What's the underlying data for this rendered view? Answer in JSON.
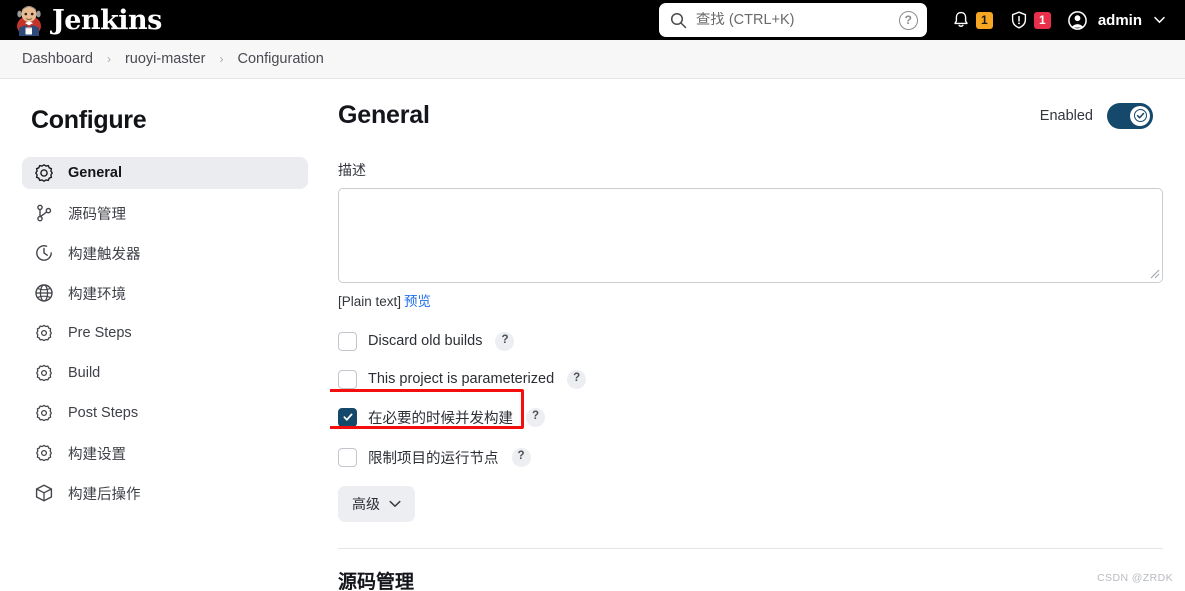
{
  "topbar": {
    "brand": "Jenkins",
    "logo_icon": "jenkins-butler-logo",
    "search": {
      "icon": "search-icon",
      "placeholder": "查找 (CTRL+K)",
      "value": "",
      "help_icon": "question-mark-icon",
      "help_label": "?"
    },
    "notifications": {
      "icon": "bell-icon",
      "count": "1",
      "color": "#f5a623"
    },
    "security": {
      "icon": "shield-warning-icon",
      "count": "1",
      "color": "#e8304a"
    },
    "user": {
      "icon": "user-avatar-icon",
      "name": "admin",
      "caret_icon": "chevron-down-icon"
    }
  },
  "breadcrumb": {
    "separator": "›",
    "items": [
      {
        "label": "Dashboard"
      },
      {
        "label": "ruoyi-master"
      },
      {
        "label": "Configuration"
      }
    ]
  },
  "sidebar": {
    "title": "Configure",
    "items": [
      {
        "label": "General",
        "icon": "gear-icon",
        "active": true
      },
      {
        "label": "源码管理",
        "icon": "git-branch-icon",
        "active": false
      },
      {
        "label": "构建触发器",
        "icon": "clock-icon",
        "active": false
      },
      {
        "label": "构建环境",
        "icon": "globe-icon",
        "active": false
      },
      {
        "label": "Pre Steps",
        "icon": "gear-icon",
        "active": false
      },
      {
        "label": "Build",
        "icon": "gear-icon",
        "active": false
      },
      {
        "label": "Post Steps",
        "icon": "gear-icon",
        "active": false
      },
      {
        "label": "构建设置",
        "icon": "gear-icon",
        "active": false
      },
      {
        "label": "构建后操作",
        "icon": "package-box-icon",
        "active": false
      }
    ]
  },
  "main": {
    "title": "General",
    "enabled": {
      "label": "Enabled",
      "state": "on",
      "toggle_color": "#14496b",
      "check_icon": "check-icon"
    },
    "description": {
      "label": "描述",
      "value": "",
      "placeholder": "",
      "format_note": "[Plain text]",
      "preview_link": "预览"
    },
    "checkboxes": [
      {
        "label": "Discard old builds",
        "checked": false,
        "help_label": "?",
        "highlighted": false
      },
      {
        "label": "This project is parameterized",
        "checked": false,
        "help_label": "?",
        "highlighted": false
      },
      {
        "label": "在必要的时候并发构建",
        "checked": true,
        "help_label": "?",
        "highlighted": true
      },
      {
        "label": "限制项目的运行节点",
        "checked": false,
        "help_label": "?",
        "highlighted": false
      }
    ],
    "advanced_button": {
      "label": "高级",
      "caret_icon": "chevron-down-icon"
    },
    "next_section_title": "源码管理"
  },
  "annotation": {
    "color": "#f50e0e",
    "target": "在必要的时候并发构建"
  },
  "watermark": "CSDN @ZRDK"
}
